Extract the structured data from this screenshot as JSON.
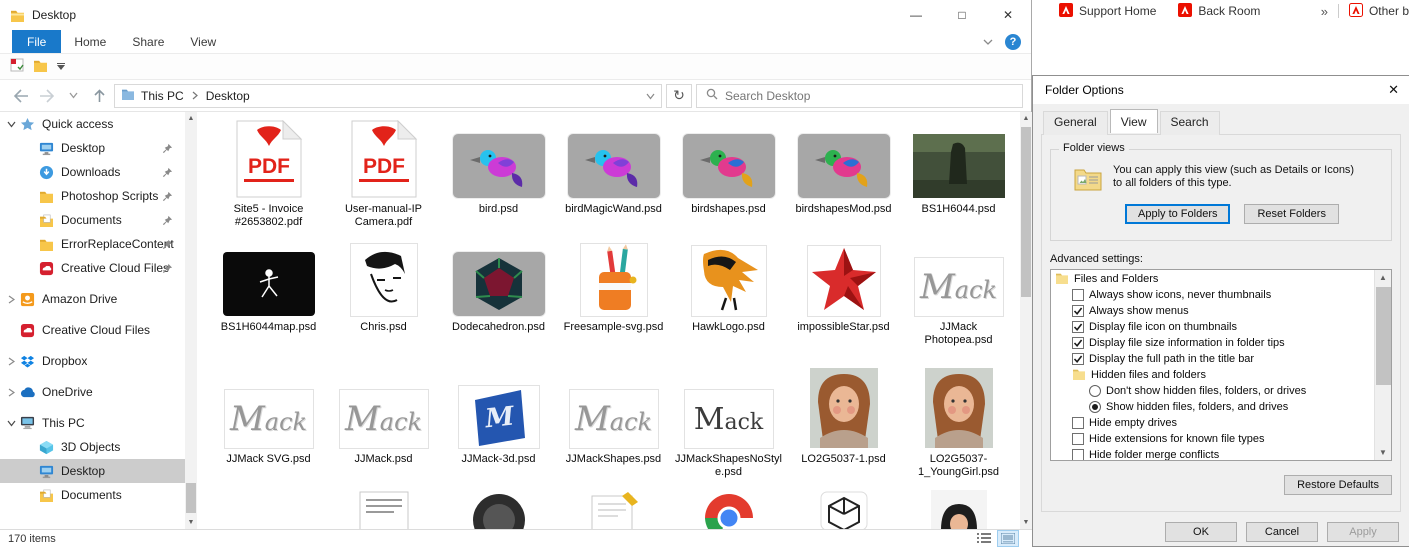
{
  "explorer": {
    "title": "Desktop",
    "menu_tabs": [
      "File",
      "Home",
      "Share",
      "View"
    ],
    "breadcrumb": [
      "This PC",
      "Desktop"
    ],
    "search_placeholder": "Search Desktop",
    "status": "170 items",
    "nav": {
      "items": [
        {
          "label": "Quick access",
          "icon": "star",
          "chevron": "down",
          "indent": 0
        },
        {
          "label": "Desktop",
          "icon": "desktop",
          "indent": 1,
          "pinned": true
        },
        {
          "label": "Downloads",
          "icon": "downloads",
          "indent": 1,
          "pinned": true
        },
        {
          "label": "Photoshop Scripts",
          "icon": "folder",
          "indent": 1,
          "pinned": true
        },
        {
          "label": "Documents",
          "icon": "documents",
          "indent": 1,
          "pinned": true
        },
        {
          "label": "ErrorReplaceContent",
          "icon": "folder",
          "indent": 1,
          "pinned": true
        },
        {
          "label": "Creative Cloud Files",
          "icon": "cc",
          "indent": 1,
          "pinned": true
        },
        {
          "label": "Amazon Drive",
          "icon": "amazon",
          "chevron": "right",
          "indent": 0,
          "gap": true
        },
        {
          "label": "Creative Cloud Files",
          "icon": "cc",
          "indent": 0,
          "gap": true
        },
        {
          "label": "Dropbox",
          "icon": "dropbox",
          "chevron": "right",
          "indent": 0,
          "gap": true
        },
        {
          "label": "OneDrive",
          "icon": "onedrive",
          "chevron": "right",
          "indent": 0,
          "gap": true
        },
        {
          "label": "This PC",
          "icon": "pc",
          "chevron": "down",
          "indent": 0,
          "gap": true
        },
        {
          "label": "3D Objects",
          "icon": "objects3d",
          "indent": 1
        },
        {
          "label": "Desktop",
          "icon": "desktop",
          "indent": 1,
          "selected": true
        },
        {
          "label": "Documents",
          "icon": "documents",
          "indent": 1
        }
      ]
    },
    "files": [
      {
        "name": "Site5 - Invoice #2653802.pdf",
        "kind": "pdf"
      },
      {
        "name": "User-manual-IP Camera.pdf",
        "kind": "pdf"
      },
      {
        "name": "bird.psd",
        "kind": "bird"
      },
      {
        "name": "birdMagicWand.psd",
        "kind": "bird"
      },
      {
        "name": "birdshapes.psd",
        "kind": "bird2"
      },
      {
        "name": "birdshapesMod.psd",
        "kind": "bird2"
      },
      {
        "name": "BS1H6044.psd",
        "kind": "photodark"
      },
      {
        "name": "BS1H6044map.psd",
        "kind": "black"
      },
      {
        "name": "Chris.psd",
        "kind": "portrait"
      },
      {
        "name": "Dodecahedron.psd",
        "kind": "dodeca"
      },
      {
        "name": "Freesample-svg.psd",
        "kind": "pencil"
      },
      {
        "name": "HawkLogo.psd",
        "kind": "hawk"
      },
      {
        "name": "impossibleStar.psd",
        "kind": "star"
      },
      {
        "name": "JJMack Photopea.psd",
        "kind": "mack"
      },
      {
        "name": "JJMack SVG.psd",
        "kind": "mack"
      },
      {
        "name": "JJMack.psd",
        "kind": "mack"
      },
      {
        "name": "JJMack-3d.psd",
        "kind": "mack3d"
      },
      {
        "name": "JJMackShapes.psd",
        "kind": "mack"
      },
      {
        "name": "JJMackShapesNoStyle.psd",
        "kind": "mackplain"
      },
      {
        "name": "LO2G5037-1.psd",
        "kind": "girl"
      },
      {
        "name": "LO2G5037-1_YoungGirl.psd",
        "kind": "girl"
      }
    ],
    "partial_row": [
      "document",
      "darkcircle",
      "notepad",
      "chrome",
      "cube",
      "avatar"
    ]
  },
  "browser": {
    "bookmarks": [
      "Support Home",
      "Back Room",
      "Other b"
    ],
    "overflow": "»"
  },
  "dialog": {
    "title": "Folder Options",
    "tabs": [
      "General",
      "View",
      "Search"
    ],
    "folder_views": {
      "group_label": "Folder views",
      "description": "You can apply this view (such as Details or Icons) to all folders of this type.",
      "apply_button": "Apply to Folders",
      "reset_button": "Reset Folders"
    },
    "advanced_label": "Advanced settings:",
    "tree": [
      {
        "type": "group",
        "label": "Files and Folders",
        "indent": 0
      },
      {
        "type": "checkbox",
        "label": "Always show icons, never thumbnails",
        "checked": false,
        "indent": 1
      },
      {
        "type": "checkbox",
        "label": "Always show menus",
        "checked": true,
        "indent": 1
      },
      {
        "type": "checkbox",
        "label": "Display file icon on thumbnails",
        "checked": true,
        "indent": 1
      },
      {
        "type": "checkbox",
        "label": "Display file size information in folder tips",
        "checked": true,
        "indent": 1
      },
      {
        "type": "checkbox",
        "label": "Display the full path in the title bar",
        "checked": true,
        "indent": 1
      },
      {
        "type": "group",
        "label": "Hidden files and folders",
        "indent": 1
      },
      {
        "type": "radio",
        "label": "Don't show hidden files, folders, or drives",
        "checked": false,
        "indent": 2
      },
      {
        "type": "radio",
        "label": "Show hidden files, folders, and drives",
        "checked": true,
        "indent": 2
      },
      {
        "type": "checkbox",
        "label": "Hide empty drives",
        "checked": false,
        "indent": 1
      },
      {
        "type": "checkbox",
        "label": "Hide extensions for known file types",
        "checked": false,
        "indent": 1
      },
      {
        "type": "checkbox",
        "label": "Hide folder merge conflicts",
        "checked": false,
        "indent": 1
      }
    ],
    "restore_button": "Restore Defaults",
    "ok": "OK",
    "cancel": "Cancel",
    "apply": "Apply"
  }
}
